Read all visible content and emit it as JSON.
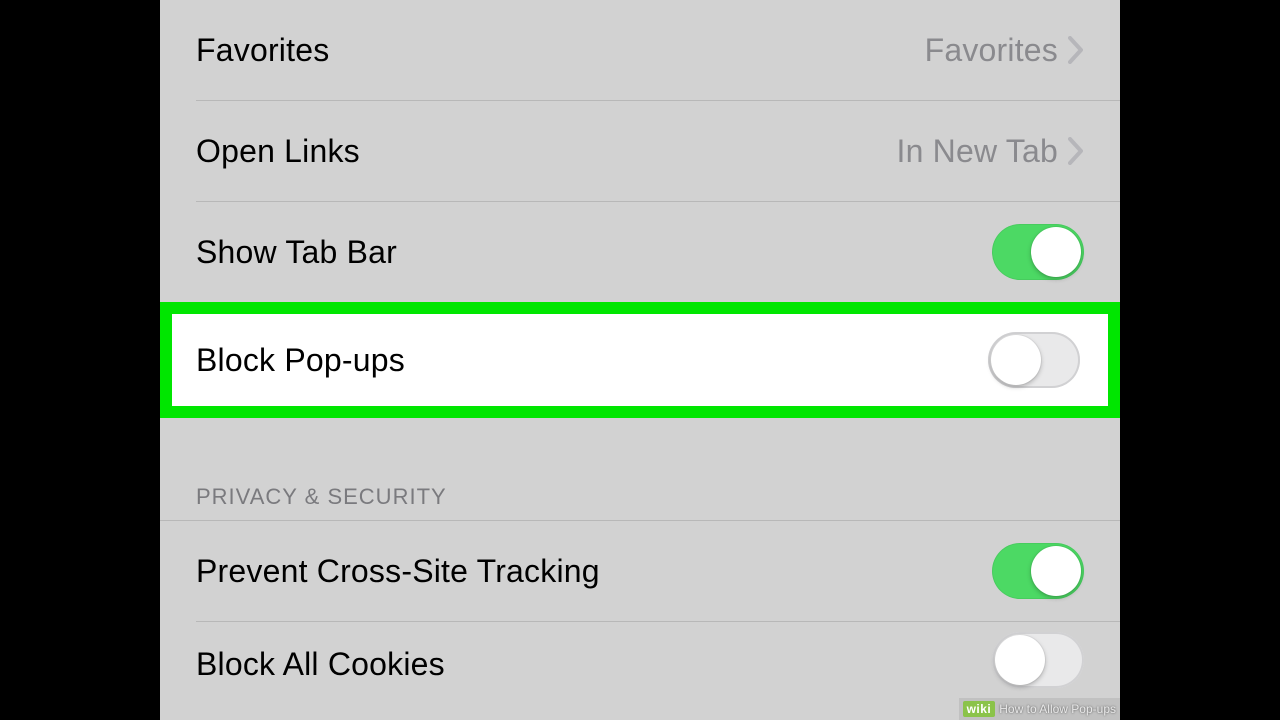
{
  "settings": {
    "general": [
      {
        "label": "Favorites",
        "value": "Favorites",
        "type": "link"
      },
      {
        "label": "Open Links",
        "value": "In New Tab",
        "type": "link"
      },
      {
        "label": "Show Tab Bar",
        "type": "toggle",
        "on": true
      },
      {
        "label": "Block Pop-ups",
        "type": "toggle",
        "on": false,
        "highlighted": true
      }
    ],
    "privacy_header": "PRIVACY & SECURITY",
    "privacy": [
      {
        "label": "Prevent Cross-Site Tracking",
        "type": "toggle",
        "on": true
      },
      {
        "label": "Block All Cookies",
        "type": "toggle",
        "on": false
      }
    ]
  },
  "watermark": {
    "logo": "wiki",
    "text": "How to Allow Pop-ups"
  },
  "colors": {
    "highlight": "#00e600",
    "toggle_on": "#4cd964",
    "background": "#d2d2d2"
  }
}
